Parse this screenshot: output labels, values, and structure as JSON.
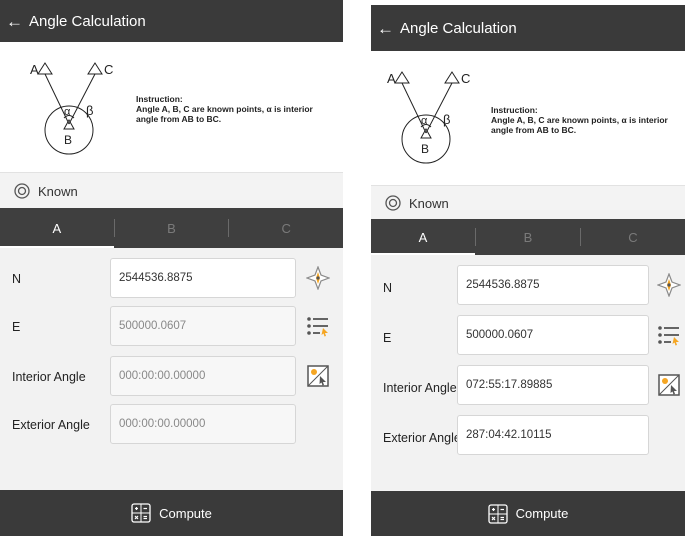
{
  "app": {
    "title": "Angle Calculation",
    "back_icon": "arrow-left-icon"
  },
  "instruction": {
    "title": "Instruction:",
    "line1": "Angle A, B, C are known points, α is interior",
    "line2": "angle from AB to BC.",
    "diagram": {
      "label_a": "A",
      "label_c": "C",
      "label_b": "B",
      "label_alpha": "α",
      "label_beta": "β"
    }
  },
  "known": {
    "label": "Known",
    "icon": "target-icon"
  },
  "tabs": [
    {
      "label": "A",
      "active": true
    },
    {
      "label": "B",
      "active": false
    },
    {
      "label": "C",
      "active": false
    }
  ],
  "fields": {
    "n_label": "N",
    "e_label": "E",
    "interior_label": "Interior Angle",
    "exterior_label": "Exterior Angle"
  },
  "screens": {
    "left": {
      "n_value": "2544536.8875",
      "e_value": "500000.0607",
      "interior_value": "000:00:00.00000",
      "exterior_value": "000:00:00.00000"
    },
    "right": {
      "n_value": "2544536.8875",
      "e_value": "500000.0607",
      "interior_value": "072:55:17.89885",
      "exterior_value": "287:04:42.10115"
    }
  },
  "footer": {
    "compute_label": "Compute",
    "compute_icon": "calculator-icon"
  },
  "icons": {
    "n_action": "compass-icon",
    "e_action": "point-list-icon",
    "interior_action": "map-pick-icon"
  },
  "colors": {
    "appbar": "#3a3a3a",
    "accent_orange": "#f5a623",
    "tab_active": "#ffffff"
  }
}
